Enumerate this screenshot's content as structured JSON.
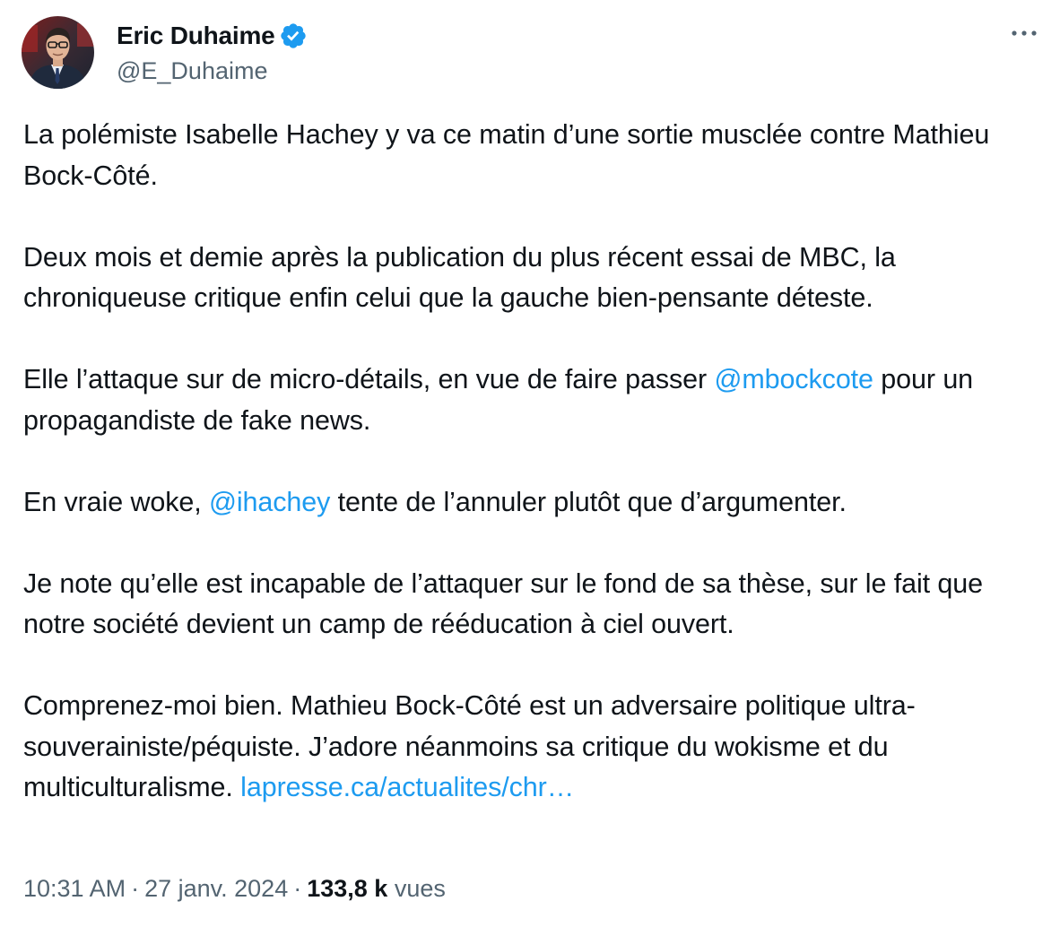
{
  "author": {
    "display_name": "Eric Duhaime",
    "handle": "@E_Duhaime",
    "verified_color": "#1d9bf0"
  },
  "more_icon": "more-horizontal-icon",
  "paragraphs": {
    "p1": "La polémiste Isabelle Hachey y va ce matin d’une sortie musclée contre Mathieu Bock-Côté.",
    "p2": "Deux mois et demie après la publication du plus récent essai de MBC, la chroniqueuse critique enfin celui que la gauche bien-pensante déteste.",
    "p3_before": "Elle l’attaque sur de micro-détails, en vue de faire passer ",
    "p3_mention": "@mbockcote",
    "p3_after": " pour un propagandiste de fake news.",
    "p4_before": "En vraie woke, ",
    "p4_mention": "@ihachey",
    "p4_after": " tente de l’annuler plutôt que d’argumenter.",
    "p5": "Je note qu’elle est incapable de l’attaquer sur le fond de sa thèse, sur le fait que notre société devient un camp de rééducation à ciel ouvert.",
    "p6_before": "Comprenez-moi bien. Mathieu Bock-Côté est un adversaire politique ultra-souverainiste/péquiste. J’adore néanmoins sa critique du wokisme et du multiculturalisme. ",
    "p6_link": "lapresse.ca/actualites/chr…"
  },
  "meta": {
    "time": "10:31 AM",
    "separator": "·",
    "date": "27 janv. 2024",
    "views_count": "133,8 k",
    "views_label": "vues"
  },
  "colors": {
    "text": "#0f1419",
    "secondary": "#536471",
    "link": "#1d9bf0"
  }
}
